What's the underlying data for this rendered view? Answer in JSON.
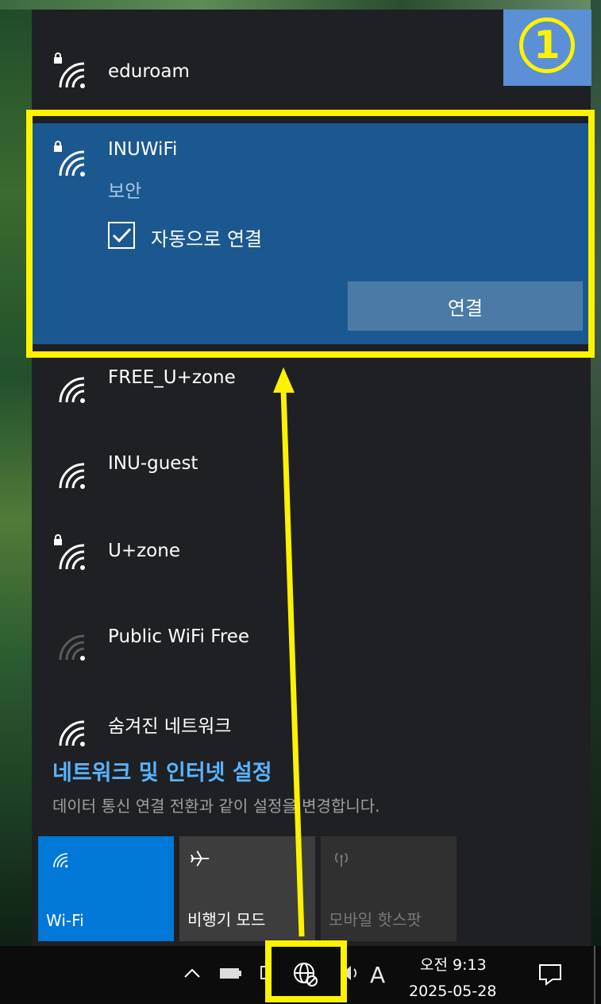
{
  "networks": {
    "eduroam": {
      "name": "eduroam",
      "secured": true
    },
    "inuwifi": {
      "name": "INUWiFi",
      "status": "보안",
      "auto_connect_label": "자동으로 연결",
      "auto_connect_checked": true,
      "connect_button": "연결"
    },
    "free_uzone": {
      "name": "FREE_U+zone",
      "secured": false
    },
    "inu_guest": {
      "name": "INU-guest",
      "secured": false
    },
    "uzone": {
      "name": "U+zone",
      "secured": true
    },
    "public_wifi": {
      "name": "Public WiFi Free",
      "secured": false
    },
    "hidden": {
      "name": "숨겨진 네트워크",
      "secured": false
    }
  },
  "settings": {
    "link": "네트워크 및 인터넷 설정",
    "description": "데이터 통신 연결 전환과 같이 설정을 변경합니다."
  },
  "quick_actions": [
    {
      "label": "Wi-Fi",
      "icon": "wifi-icon",
      "active": true
    },
    {
      "label": "비행기 모드",
      "icon": "airplane-icon",
      "active": false
    },
    {
      "label": "모바일 핫스팟",
      "icon": "hotspot-icon",
      "active": false,
      "disabled": true
    }
  ],
  "taskbar": {
    "ime_indicator": "A",
    "time": "오전 9:13",
    "date": "2025-05-28"
  },
  "annotation": {
    "step": "1"
  },
  "colors": {
    "highlight": "#fff200",
    "selected_bg": "#1c5890",
    "wifi_tile_active": "#0078d7",
    "link": "#5ab3ff"
  }
}
